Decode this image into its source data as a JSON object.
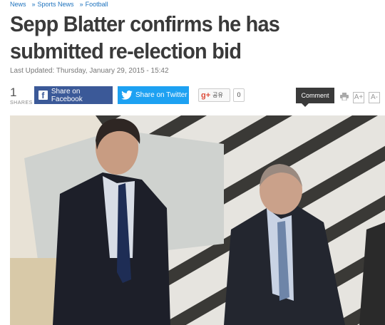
{
  "breadcrumb": [
    "News",
    "Sports News",
    "Football"
  ],
  "article": {
    "title": "Sepp Blatter confirms he has submitted re-election bid",
    "last_updated": "Last Updated: Thursday, January 29, 2015 - 15:42"
  },
  "share_bar": {
    "count": "1",
    "count_label": "SHARES",
    "facebook_label": "Share on Facebook",
    "twitter_label": "Share on Twitter",
    "gplus_label": "공유",
    "gplus_count": "0",
    "comment_label": "Comment",
    "font_up": "A+",
    "font_down": "A-"
  },
  "colors": {
    "facebook": "#3b5998",
    "twitter": "#1da1f2",
    "link": "#1e73be",
    "title": "#3a3a3a"
  },
  "icons": [
    "facebook-icon",
    "twitter-icon",
    "google-plus-icon",
    "print-icon"
  ]
}
